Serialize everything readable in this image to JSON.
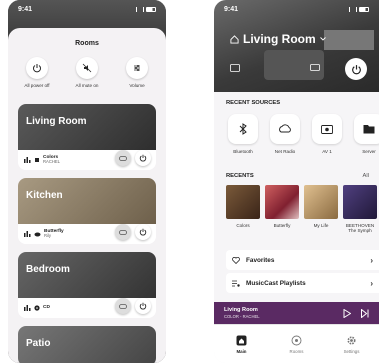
{
  "left": {
    "status_time": "9:41",
    "sheet_title": "Rooms",
    "quick_actions": [
      {
        "label": "All power off",
        "icon": "power-icon"
      },
      {
        "label": "All mute on",
        "icon": "mute-icon"
      },
      {
        "label": "Volume",
        "icon": "sliders-icon"
      }
    ],
    "rooms": [
      {
        "name": "Living Room",
        "track": "Colors",
        "artist": "RACHEL",
        "bg": "#3a3a3a"
      },
      {
        "name": "Kitchen",
        "track": "Butterfly",
        "artist": "Rily",
        "bg": "#8a7c67"
      },
      {
        "name": "Bedroom",
        "track": "CD",
        "artist": "",
        "bg": "#4a4a4a"
      },
      {
        "name": "Patio",
        "track": "",
        "artist": "",
        "bg": "#5d5d5d"
      }
    ]
  },
  "right": {
    "status_time": "9:41",
    "room_title": "Living Room",
    "recent_sources_title": "RECENT SOURCES",
    "sources": [
      {
        "label": "Bluetooth",
        "icon": "bluetooth-icon"
      },
      {
        "label": "Net Radio",
        "icon": "cloud-radio-icon"
      },
      {
        "label": "AV 1",
        "icon": "av-input-icon"
      },
      {
        "label": "Server",
        "icon": "server-folder-icon"
      }
    ],
    "recents_title": "RECENTS",
    "recents_all": "All",
    "recents": [
      {
        "label": "Colors",
        "color": "#5a3a2a"
      },
      {
        "label": "Butterfly",
        "color": "#a04040"
      },
      {
        "label": "My Life",
        "color": "#c8a070"
      },
      {
        "label": "BEETHOVEN",
        "label2": "The Symph",
        "color": "#3a3060"
      }
    ],
    "favorites_label": "Favorites",
    "playlists_label": "MusicCast Playlists",
    "now_playing": {
      "room": "Living Room",
      "track": "COLOR - RACHEL"
    },
    "tabs": [
      {
        "label": "Main",
        "icon": "home-icon",
        "active": true
      },
      {
        "label": "Rooms",
        "icon": "rooms-icon",
        "active": false
      },
      {
        "label": "Settings",
        "icon": "gear-icon",
        "active": false
      }
    ],
    "accent_color": "#5a2a63"
  }
}
